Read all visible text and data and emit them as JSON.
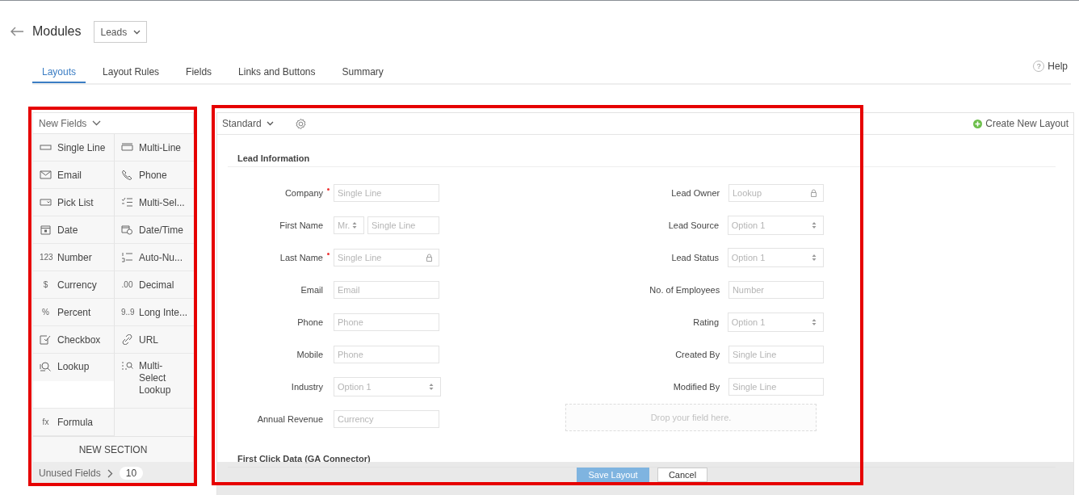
{
  "header": {
    "title": "Modules",
    "module_select": "Leads"
  },
  "tabs": [
    {
      "label": "Layouts",
      "selected": true
    },
    {
      "label": "Layout Rules",
      "selected": false
    },
    {
      "label": "Fields",
      "selected": false
    },
    {
      "label": "Links and Buttons",
      "selected": false
    },
    {
      "label": "Summary",
      "selected": false
    }
  ],
  "help": {
    "glyph": "?",
    "label": "Help"
  },
  "new_fields": {
    "title": "New Fields",
    "items": [
      {
        "label": "Single Line"
      },
      {
        "label": "Multi-Line"
      },
      {
        "label": "Email"
      },
      {
        "label": "Phone"
      },
      {
        "label": "Pick List"
      },
      {
        "label": "Multi-Sel..."
      },
      {
        "label": "Date"
      },
      {
        "label": "Date/Time"
      },
      {
        "label": "Number",
        "glyph": "123"
      },
      {
        "label": "Auto-Nu..."
      },
      {
        "label": "Currency",
        "glyph": "$"
      },
      {
        "label": "Decimal",
        "glyph": ".00"
      },
      {
        "label": "Percent",
        "glyph": "%"
      },
      {
        "label": "Long Inte...",
        "glyph": "9..9"
      },
      {
        "label": "Checkbox"
      },
      {
        "label": "URL"
      },
      {
        "label": "Lookup"
      },
      {
        "label": "Multi-Select Lookup"
      },
      {
        "label": "Formula",
        "glyph": "fx"
      }
    ],
    "new_section": "NEW SECTION",
    "unused_label": "Unused Fields",
    "unused_count": "10"
  },
  "layout": {
    "select": "Standard",
    "create": "Create New Layout"
  },
  "sections": [
    {
      "title": "Lead Information",
      "left": [
        {
          "label": "Company",
          "required": true,
          "kind": "text",
          "placeholder": "Single Line",
          "locked": false
        },
        {
          "label": "First Name",
          "required": false,
          "kind": "name",
          "salutation": "Mr.",
          "placeholder": "Single Line",
          "locked": false
        },
        {
          "label": "Last Name",
          "required": true,
          "kind": "text",
          "placeholder": "Single Line",
          "locked": true
        },
        {
          "label": "Email",
          "required": false,
          "kind": "text",
          "placeholder": "Email",
          "locked": false
        },
        {
          "label": "Phone",
          "required": false,
          "kind": "text",
          "placeholder": "Phone",
          "locked": false
        },
        {
          "label": "Mobile",
          "required": false,
          "kind": "text",
          "placeholder": "Phone",
          "locked": false
        },
        {
          "label": "Industry",
          "required": false,
          "kind": "select",
          "placeholder": "Option 1",
          "locked": false
        },
        {
          "label": "Annual Revenue",
          "required": false,
          "kind": "text",
          "placeholder": "Currency",
          "locked": false
        }
      ],
      "right": [
        {
          "label": "Lead Owner",
          "required": false,
          "kind": "text",
          "placeholder": "Lookup",
          "locked": true
        },
        {
          "label": "Lead Source",
          "required": false,
          "kind": "select",
          "placeholder": "Option 1",
          "locked": false
        },
        {
          "label": "Lead Status",
          "required": false,
          "kind": "select",
          "placeholder": "Option 1",
          "locked": false
        },
        {
          "label": "No. of Employees",
          "required": false,
          "kind": "text",
          "placeholder": "Number",
          "locked": false
        },
        {
          "label": "Rating",
          "required": false,
          "kind": "select",
          "placeholder": "Option 1",
          "locked": false
        },
        {
          "label": "Created By",
          "required": false,
          "kind": "text",
          "placeholder": "Single Line",
          "locked": false
        },
        {
          "label": "Modified By",
          "required": false,
          "kind": "text",
          "placeholder": "Single Line",
          "locked": false
        }
      ],
      "drop_zone": "Drop your field here."
    },
    {
      "title": "First Click Data (GA Connector)"
    }
  ],
  "footer": {
    "save": "Save Layout",
    "cancel": "Cancel"
  }
}
